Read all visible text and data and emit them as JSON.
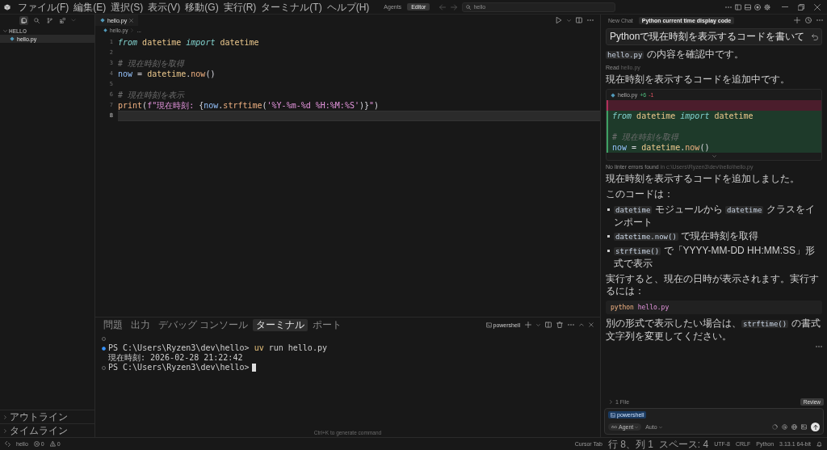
{
  "titlebar": {
    "menu": [
      "ファイル(F)",
      "編集(E)",
      "選択(S)",
      "表示(V)",
      "移動(G)",
      "実行(R)",
      "ターミナル(T)",
      "ヘルプ(H)"
    ],
    "modes": [
      {
        "label": "Agents",
        "selected": false
      },
      {
        "label": "Editor",
        "selected": true
      }
    ],
    "command_center": {
      "label": "hello"
    }
  },
  "sidebar": {
    "views": [
      {
        "selected": true
      },
      {
        "selected": false
      },
      {
        "selected": false
      },
      {
        "selected": false
      }
    ],
    "folder": {
      "name": "HELLO",
      "expanded": true,
      "files": [
        {
          "name": "hello.py",
          "selected": true
        }
      ]
    },
    "sections": [
      {
        "label": "アウトライン",
        "expanded": false
      },
      {
        "label": "タイムライン",
        "expanded": false
      }
    ]
  },
  "editor": {
    "tabs": [
      {
        "label": "hello.py",
        "selected": true
      }
    ],
    "breadcrumb": [
      {
        "label": "hello.py"
      },
      {
        "label": "..."
      }
    ],
    "lines": [
      {
        "number": "1",
        "current": false,
        "tokens": [
          {
            "kind": "keyword",
            "text": "from"
          },
          {
            "kind": "class",
            "text": " datetime"
          },
          {
            "kind": "keyword",
            "text": " import"
          },
          {
            "kind": "class",
            "text": " datetime"
          }
        ]
      },
      {
        "number": "2",
        "current": false
      },
      {
        "number": "3",
        "current": false,
        "tokens": [
          {
            "kind": "comment",
            "text": "# 現在時刻を取得"
          }
        ]
      },
      {
        "number": "4",
        "current": false,
        "tokens": [
          {
            "kind": "variable",
            "text": "now"
          },
          {
            "kind": "plain",
            "text": " = "
          },
          {
            "kind": "class",
            "text": "datetime"
          },
          {
            "kind": "plain",
            "text": "."
          },
          {
            "kind": "function",
            "text": "now"
          },
          {
            "kind": "plain",
            "text": "()"
          }
        ]
      },
      {
        "number": "5",
        "current": false
      },
      {
        "number": "6",
        "current": false,
        "tokens": [
          {
            "kind": "comment",
            "text": "# 現在時刻を表示"
          }
        ]
      },
      {
        "number": "7",
        "current": false,
        "tokens": [
          {
            "kind": "function",
            "text": "print"
          },
          {
            "kind": "plain",
            "text": "("
          },
          {
            "kind": "string",
            "text": "f\"現在時刻: "
          },
          {
            "kind": "plain",
            "text": "{"
          },
          {
            "kind": "variable",
            "text": "now"
          },
          {
            "kind": "plain",
            "text": "."
          },
          {
            "kind": "function",
            "text": "strftime"
          },
          {
            "kind": "plain",
            "text": "("
          },
          {
            "kind": "string",
            "text": "'%Y-%m-%d %H:%M:%S'"
          },
          {
            "kind": "plain",
            "text": ")}"
          },
          {
            "kind": "string",
            "text": "\""
          },
          {
            "kind": "plain",
            "text": ")"
          }
        ]
      },
      {
        "number": "8",
        "current": true
      }
    ]
  },
  "panel": {
    "tabs": [
      {
        "label": "問題",
        "selected": false
      },
      {
        "label": "出力",
        "selected": false
      },
      {
        "label": "デバッグ コンソール",
        "selected": false
      },
      {
        "label": "ターミナル",
        "selected": true
      },
      {
        "label": "ポート",
        "selected": false
      }
    ],
    "shell": "powershell",
    "lines": [
      {
        "kind": "marker",
        "completed": false
      },
      {
        "kind": "command",
        "completed": true,
        "prompt": "PS C:\\Users\\Ryzen3\\dev\\hello>",
        "program": "uv",
        "args": "run hello.py",
        "cursor": false
      },
      {
        "kind": "output",
        "text": "現在時刻: 2026-02-28 21:22:42"
      },
      {
        "kind": "command",
        "completed": false,
        "prompt": "PS C:\\Users\\Ryzen3\\dev\\hello>",
        "cursor": true
      }
    ],
    "hint": "Ctrl+K to generate command"
  },
  "chat": {
    "tabs": [
      {
        "label": "New Chat",
        "selected": false
      },
      {
        "label": "Python current time display code",
        "selected": true
      }
    ],
    "blocks": [
      {
        "kind": "user",
        "text": "Pythonで現在時刻を表示するコードを書いて"
      },
      {
        "kind": "paragraph",
        "segments": [
          {
            "kind": "code",
            "text": "hello.py"
          },
          {
            "kind": "text",
            "text": " の内容を確認中です。"
          }
        ]
      },
      {
        "kind": "tool",
        "action": "Read",
        "target": "hello.py"
      },
      {
        "kind": "paragraph",
        "segments": [
          {
            "kind": "text",
            "text": "現在時刻を表示するコードを追加中です。"
          }
        ]
      },
      {
        "kind": "diff",
        "file": "hello.py",
        "added": "+6",
        "removed": "-1",
        "lines": [
          {
            "kind": "removed"
          },
          {
            "kind": "added",
            "tokens": [
              {
                "kind": "keyword",
                "text": "from"
              },
              {
                "kind": "class",
                "text": " datetime"
              },
              {
                "kind": "keyword",
                "text": " import"
              },
              {
                "kind": "class",
                "text": " datetime"
              }
            ]
          },
          {
            "kind": "added"
          },
          {
            "kind": "added",
            "tokens": [
              {
                "kind": "comment",
                "text": "# 現在時刻を取得"
              }
            ]
          },
          {
            "kind": "added",
            "tokens": [
              {
                "kind": "variable",
                "text": "now"
              },
              {
                "kind": "plain",
                "text": " = "
              },
              {
                "kind": "class",
                "text": "datetime"
              },
              {
                "kind": "plain",
                "text": "."
              },
              {
                "kind": "function",
                "text": "now"
              },
              {
                "kind": "plain",
                "text": "()"
              }
            ]
          }
        ]
      },
      {
        "kind": "note",
        "text": "No linter errors found",
        "detail": "in c:\\Users\\Ryzen3\\dev\\hello\\hello.py"
      },
      {
        "kind": "paragraph",
        "segments": [
          {
            "kind": "text",
            "text": "現在時刻を表示するコードを追加しました。"
          }
        ]
      },
      {
        "kind": "paragraph",
        "segments": [
          {
            "kind": "text",
            "text": "このコードは："
          }
        ]
      },
      {
        "kind": "list",
        "items": [
          [
            {
              "kind": "code",
              "text": "datetime"
            },
            {
              "kind": "text",
              "text": " モジュールから "
            },
            {
              "kind": "code",
              "text": "datetime"
            },
            {
              "kind": "text",
              "text": " クラスをインポート"
            }
          ],
          [
            {
              "kind": "code",
              "text": "datetime.now()"
            },
            {
              "kind": "text",
              "text": " で現在時刻を取得"
            }
          ],
          [
            {
              "kind": "code",
              "text": "strftime()"
            },
            {
              "kind": "text",
              "text": " で「YYYY-MM-DD HH:MM:SS」形式で表示"
            }
          ]
        ]
      },
      {
        "kind": "paragraph",
        "segments": [
          {
            "kind": "text",
            "text": "実行すると、現在の日時が表示されます。実行するには："
          }
        ]
      },
      {
        "kind": "code",
        "tokens": [
          {
            "kind": "function",
            "text": "python"
          },
          {
            "kind": "string",
            "text": " hello.py"
          }
        ]
      },
      {
        "kind": "paragraph",
        "segments": [
          {
            "kind": "text",
            "text": "別の形式で表示したい場合は、"
          },
          {
            "kind": "code",
            "text": "strftime()"
          },
          {
            "kind": "text",
            "text": " の書式文字列を変更してください。"
          }
        ]
      }
    ],
    "changes": {
      "label": "1 File",
      "expanded": false
    },
    "review": "Review",
    "composer": {
      "context": [
        "powershell"
      ],
      "mode": "Agent",
      "model": "Auto"
    }
  },
  "statusbar": {
    "workspace": "hello",
    "errors": "0",
    "warnings": "0",
    "items": [
      "Cursor Tab",
      "行 8、列 1",
      "スペース: 4",
      "UTF-8",
      "CRLF",
      "Python",
      "3.13.1 64-bit"
    ]
  }
}
